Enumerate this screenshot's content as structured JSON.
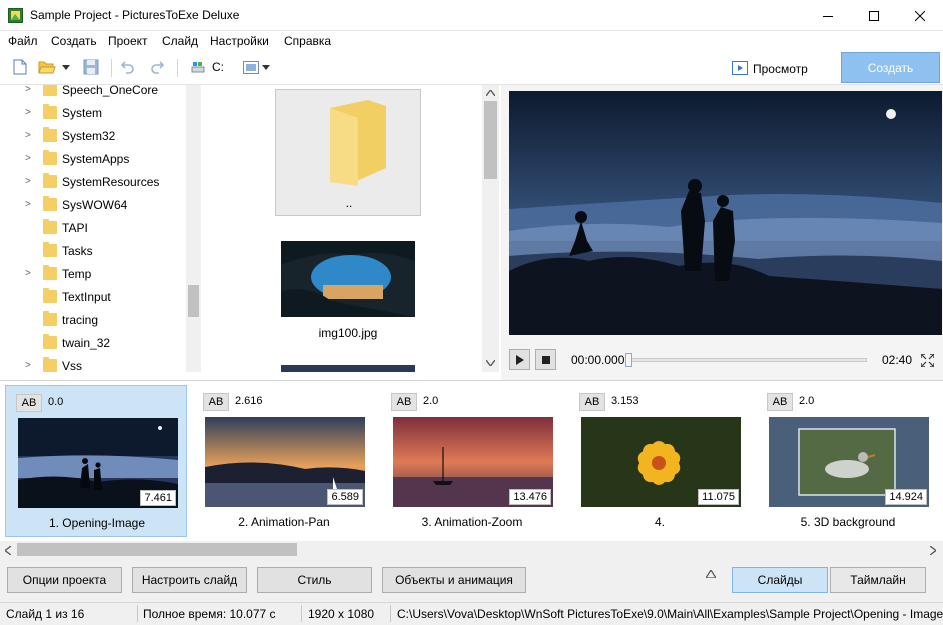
{
  "window": {
    "title": "Sample Project - PicturesToExe Deluxe",
    "icons": {
      "app": "app-icon",
      "minimize": "minimize-icon",
      "maximize": "maximize-icon",
      "close": "close-icon"
    }
  },
  "menu": [
    "Файл",
    "Создать",
    "Проект",
    "Слайд",
    "Настройки",
    "Справка"
  ],
  "toolbar": {
    "drive_label": "C:",
    "preview_label": "Просмотр",
    "create_label": "Создать"
  },
  "tree": {
    "items": [
      {
        "label": "Speech_OneCore",
        "expandable": true
      },
      {
        "label": "System",
        "expandable": true
      },
      {
        "label": "System32",
        "expandable": true
      },
      {
        "label": "SystemApps",
        "expandable": true
      },
      {
        "label": "SystemResources",
        "expandable": true
      },
      {
        "label": "SysWOW64",
        "expandable": true
      },
      {
        "label": "TAPI",
        "expandable": false
      },
      {
        "label": "Tasks",
        "expandable": false
      },
      {
        "label": "Temp",
        "expandable": true
      },
      {
        "label": "TextInput",
        "expandable": false
      },
      {
        "label": "tracing",
        "expandable": false
      },
      {
        "label": "twain_32",
        "expandable": false
      },
      {
        "label": "Vss",
        "expandable": true
      }
    ]
  },
  "files": {
    "items": [
      {
        "label": "..",
        "type": "folder"
      },
      {
        "label": "img100.jpg",
        "type": "image"
      }
    ]
  },
  "player": {
    "current_time": "00:00.000",
    "total_time": "02:40",
    "progress": 0.0
  },
  "slides": [
    {
      "ab": "AB",
      "transition": "0.0",
      "duration": "7.461",
      "label": "1. Opening-Image",
      "selected": true
    },
    {
      "ab": "AB",
      "transition": "2.616",
      "duration": "6.589",
      "label": "2. Animation-Pan",
      "selected": false
    },
    {
      "ab": "AB",
      "transition": "2.0",
      "duration": "13.476",
      "label": "3. Animation-Zoom",
      "selected": false
    },
    {
      "ab": "AB",
      "transition": "3.153",
      "duration": "11.075",
      "label": "4.",
      "selected": false
    },
    {
      "ab": "AB",
      "transition": "2.0",
      "duration": "14.924",
      "label": "5. 3D background",
      "selected": false
    }
  ],
  "bottom_buttons": {
    "project_options": "Опции проекта",
    "customize_slide": "Настроить слайд",
    "style": "Стиль",
    "objects_animation": "Объекты и анимация",
    "slides_tab": "Слайды",
    "timeline_tab": "Таймлайн"
  },
  "status": {
    "slide": "Слайд 1 из 16",
    "total_time": "Полное время: 10.077 с",
    "resolution": "1920 x 1080",
    "path": "C:\\Users\\Vova\\Desktop\\WnSoft PicturesToExe\\9.0\\Main\\All\\Examples\\Sample Project\\Opening - Image"
  },
  "colors": {
    "accent": "#8ec0f0",
    "selection": "#cde4f7",
    "folder": "#f4cf66"
  }
}
